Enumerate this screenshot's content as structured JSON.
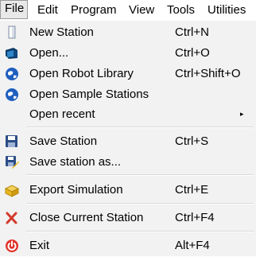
{
  "menubar": {
    "file": "File",
    "edit": "Edit",
    "program": "Program",
    "view": "View",
    "tools": "Tools",
    "utilities": "Utilities"
  },
  "file_menu": {
    "new_station": {
      "label": "New Station",
      "shortcut": "Ctrl+N",
      "icon": "new-file-icon"
    },
    "open": {
      "label": "Open...",
      "shortcut": "Ctrl+O",
      "icon": "open-station-icon"
    },
    "open_robot_library": {
      "label": "Open Robot Library",
      "shortcut": "Ctrl+Shift+O",
      "icon": "globe-icon"
    },
    "open_sample_stations": {
      "label": "Open Sample Stations",
      "icon": "globe-icon"
    },
    "open_recent": {
      "label": "Open recent",
      "submenu_glyph": "▸"
    },
    "save_station": {
      "label": "Save Station",
      "shortcut": "Ctrl+S",
      "icon": "floppy-disk-icon"
    },
    "save_station_as": {
      "label": "Save station as...",
      "icon": "floppy-disk-pencil-icon"
    },
    "export_simulation": {
      "label": "Export Simulation",
      "shortcut": "Ctrl+E",
      "icon": "export-box-icon"
    },
    "close_current_station": {
      "label": "Close Current Station",
      "shortcut": "Ctrl+F4",
      "icon": "red-x-icon"
    },
    "exit": {
      "label": "Exit",
      "shortcut": "Alt+F4",
      "icon": "power-icon"
    }
  },
  "colors": {
    "menu_background": "#f2f2f2",
    "separator": "#d9d9d9",
    "active_menu_background": "#e8e8e8",
    "globe_blue": "#1f5fbf",
    "close_red": "#d33a2c",
    "exit_red": "#e0342a",
    "export_gold": "#e8b820"
  }
}
